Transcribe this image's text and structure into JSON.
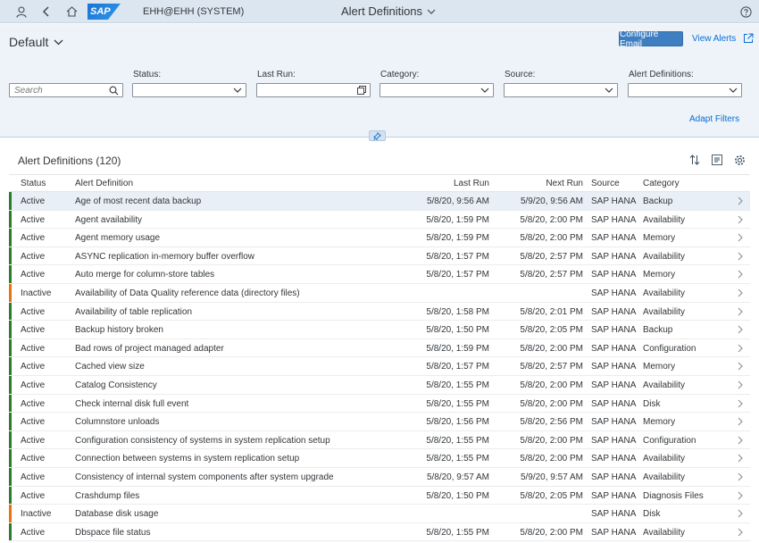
{
  "shell": {
    "system": "EHH@EHH (SYSTEM)",
    "app_title": "Alert Definitions",
    "logo_text": "SAP"
  },
  "header": {
    "variant": "Default",
    "configure_email": "Configure Email",
    "view_alerts": "View Alerts",
    "adapt_filters": "Adapt Filters"
  },
  "filters": {
    "search_placeholder": "Search",
    "status_label": "Status:",
    "last_run_label": "Last Run:",
    "category_label": "Category:",
    "source_label": "Source:",
    "alert_definitions_label": "Alert Definitions:"
  },
  "table": {
    "title": "Alert Definitions (120)",
    "columns": {
      "status": "Status",
      "definition": "Alert Definition",
      "last_run": "Last Run",
      "next_run": "Next Run",
      "source": "Source",
      "category": "Category"
    },
    "rows": [
      {
        "status": "Active",
        "definition": "Age of most recent data backup",
        "last_run": "5/8/20, 9:56 AM",
        "next_run": "5/9/20, 9:56 AM",
        "source": "SAP HANA",
        "category": "Backup"
      },
      {
        "status": "Active",
        "definition": "Agent availability",
        "last_run": "5/8/20, 1:59 PM",
        "next_run": "5/8/20, 2:00 PM",
        "source": "SAP HANA",
        "category": "Availability"
      },
      {
        "status": "Active",
        "definition": "Agent memory usage",
        "last_run": "5/8/20, 1:59 PM",
        "next_run": "5/8/20, 2:00 PM",
        "source": "SAP HANA",
        "category": "Memory"
      },
      {
        "status": "Active",
        "definition": "ASYNC replication in-memory buffer overflow",
        "last_run": "5/8/20, 1:57 PM",
        "next_run": "5/8/20, 2:57 PM",
        "source": "SAP HANA",
        "category": "Availability"
      },
      {
        "status": "Active",
        "definition": "Auto merge for column-store tables",
        "last_run": "5/8/20, 1:57 PM",
        "next_run": "5/8/20, 2:57 PM",
        "source": "SAP HANA",
        "category": "Memory"
      },
      {
        "status": "Inactive",
        "definition": "Availability of Data Quality reference data (directory files)",
        "last_run": "",
        "next_run": "",
        "source": "SAP HANA",
        "category": "Availability"
      },
      {
        "status": "Active",
        "definition": "Availability of table replication",
        "last_run": "5/8/20, 1:58 PM",
        "next_run": "5/8/20, 2:01 PM",
        "source": "SAP HANA",
        "category": "Availability"
      },
      {
        "status": "Active",
        "definition": "Backup history broken",
        "last_run": "5/8/20, 1:50 PM",
        "next_run": "5/8/20, 2:05 PM",
        "source": "SAP HANA",
        "category": "Backup"
      },
      {
        "status": "Active",
        "definition": "Bad rows of project managed adapter",
        "last_run": "5/8/20, 1:59 PM",
        "next_run": "5/8/20, 2:00 PM",
        "source": "SAP HANA",
        "category": "Configuration"
      },
      {
        "status": "Active",
        "definition": "Cached view size",
        "last_run": "5/8/20, 1:57 PM",
        "next_run": "5/8/20, 2:57 PM",
        "source": "SAP HANA",
        "category": "Memory"
      },
      {
        "status": "Active",
        "definition": "Catalog Consistency",
        "last_run": "5/8/20, 1:55 PM",
        "next_run": "5/8/20, 2:00 PM",
        "source": "SAP HANA",
        "category": "Availability"
      },
      {
        "status": "Active",
        "definition": "Check internal disk full event",
        "last_run": "5/8/20, 1:55 PM",
        "next_run": "5/8/20, 2:00 PM",
        "source": "SAP HANA",
        "category": "Disk"
      },
      {
        "status": "Active",
        "definition": "Columnstore unloads",
        "last_run": "5/8/20, 1:56 PM",
        "next_run": "5/8/20, 2:56 PM",
        "source": "SAP HANA",
        "category": "Memory"
      },
      {
        "status": "Active",
        "definition": "Configuration consistency of systems in system replication setup",
        "last_run": "5/8/20, 1:55 PM",
        "next_run": "5/8/20, 2:00 PM",
        "source": "SAP HANA",
        "category": "Configuration"
      },
      {
        "status": "Active",
        "definition": "Connection between systems in system replication setup",
        "last_run": "5/8/20, 1:55 PM",
        "next_run": "5/8/20, 2:00 PM",
        "source": "SAP HANA",
        "category": "Availability"
      },
      {
        "status": "Active",
        "definition": "Consistency of internal system components after system upgrade",
        "last_run": "5/8/20, 9:57 AM",
        "next_run": "5/9/20, 9:57 AM",
        "source": "SAP HANA",
        "category": "Availability"
      },
      {
        "status": "Active",
        "definition": "Crashdump files",
        "last_run": "5/8/20, 1:50 PM",
        "next_run": "5/8/20, 2:05 PM",
        "source": "SAP HANA",
        "category": "Diagnosis Files"
      },
      {
        "status": "Inactive",
        "definition": "Database disk usage",
        "last_run": "",
        "next_run": "",
        "source": "SAP HANA",
        "category": "Disk"
      },
      {
        "status": "Active",
        "definition": "Dbspace file status",
        "last_run": "5/8/20, 1:55 PM",
        "next_run": "5/8/20, 2:00 PM",
        "source": "SAP HANA",
        "category": "Availability"
      }
    ]
  },
  "colors": {
    "active": "#2b7d2b",
    "inactive": "#e9730c",
    "accent": "#0a6ed1"
  }
}
